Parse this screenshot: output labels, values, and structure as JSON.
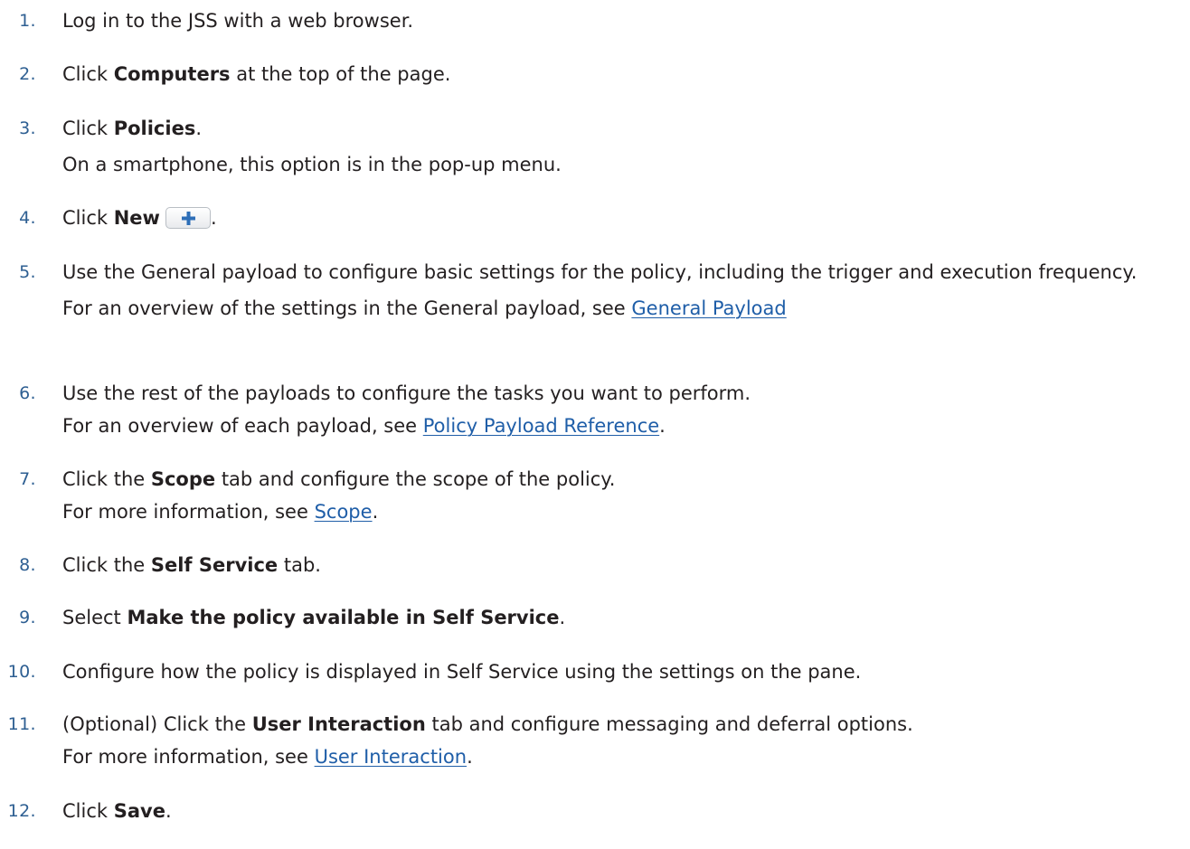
{
  "steps": [
    {
      "number": "1.",
      "text": "Log in to the JSS with a web browser."
    },
    {
      "number": "2.",
      "pre": "Click ",
      "bold": "Computers",
      "post": " at the top of the page."
    },
    {
      "number": "3.",
      "pre": "Click ",
      "bold": "Policies",
      "post": ".",
      "note": "On a smartphone, this option is in the pop-up menu."
    },
    {
      "number": "4.",
      "pre": "Click ",
      "bold": "New",
      "button_icon": "plus-icon",
      "post": "."
    },
    {
      "number": "5.",
      "text": "Use the General payload to configure basic settings for the policy, including the trigger and execution frequency.",
      "note_pre": "For an overview of the settings in the General payload, see ",
      "note_link": "General Payload",
      "note_post": ""
    },
    {
      "number": "6.",
      "text": "Use the rest of the payloads to configure the tasks you want to perform.",
      "note_pre": "For an overview of each payload, see ",
      "note_link": "Policy Payload Reference",
      "note_post": "."
    },
    {
      "number": "7.",
      "pre": "Click the ",
      "bold": "Scope",
      "post": " tab and configure the scope of the policy.",
      "note_pre": "For more information, see ",
      "note_link": "Scope",
      "note_post": "."
    },
    {
      "number": "8.",
      "pre": "Click the ",
      "bold": "Self Service",
      "post": " tab."
    },
    {
      "number": "9.",
      "pre": "Select ",
      "bold": "Make the policy available in Self Service",
      "post": "."
    },
    {
      "number": "10.",
      "text": "Configure how the policy is displayed in Self Service using the settings on the pane."
    },
    {
      "number": "11.",
      "pre": "(Optional) Click the ",
      "bold": "User Interaction",
      "post": " tab and configure messaging and deferral options.",
      "note_pre": "For more information, see ",
      "note_link": "User Interaction",
      "note_post": "."
    },
    {
      "number": "12.",
      "pre": "Click ",
      "bold": "Save",
      "post": "."
    }
  ],
  "colors": {
    "text": "#231f20",
    "number": "#2e5f92",
    "link": "#1f5ea8",
    "plus_icon": "#2e6fb8"
  }
}
